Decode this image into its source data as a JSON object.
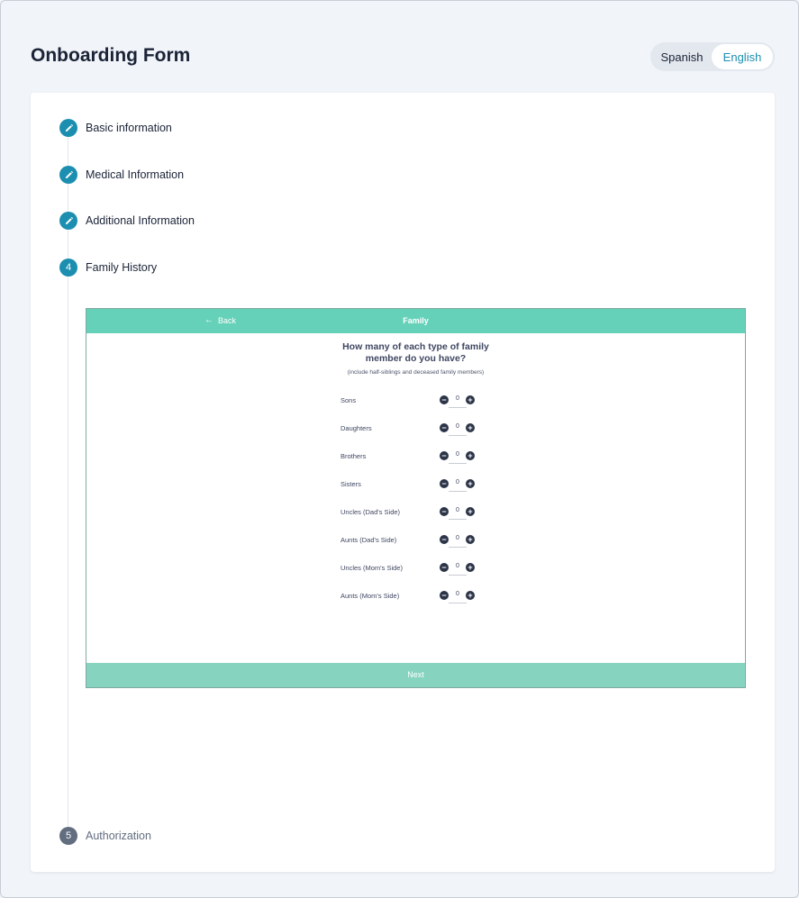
{
  "page": {
    "title": "Onboarding Form"
  },
  "language": {
    "spanish": "Spanish",
    "english": "English",
    "selected": "English"
  },
  "colors": {
    "accent": "#1c8fb0",
    "embed_header": "#66d1b9",
    "embed_footer": "#86d4c0",
    "muted": "#626d80"
  },
  "steps": [
    {
      "label": "Basic information",
      "state": "completed",
      "icon": "pencil-icon"
    },
    {
      "label": "Medical Information",
      "state": "completed",
      "icon": "pencil-icon"
    },
    {
      "label": "Additional Information",
      "state": "completed",
      "icon": "pencil-icon"
    },
    {
      "number": "4",
      "label": "Family History",
      "state": "active"
    },
    {
      "number": "5",
      "label": "Authorization",
      "state": "upcoming"
    }
  ],
  "family": {
    "back_label": "Back",
    "title": "Family",
    "question": "How many of each type of family member do you have?",
    "note": "(include half-siblings and deceased family members)",
    "counters": [
      {
        "label": "Sons",
        "value": "0"
      },
      {
        "label": "Daughters",
        "value": "0"
      },
      {
        "label": "Brothers",
        "value": "0"
      },
      {
        "label": "Sisters",
        "value": "0"
      },
      {
        "label": "Uncles (Dad's Side)",
        "value": "0"
      },
      {
        "label": "Aunts (Dad's Side)",
        "value": "0"
      },
      {
        "label": "Uncles (Mom's Side)",
        "value": "0"
      },
      {
        "label": "Aunts (Mom's Side)",
        "value": "0"
      }
    ],
    "next_label": "Next"
  }
}
